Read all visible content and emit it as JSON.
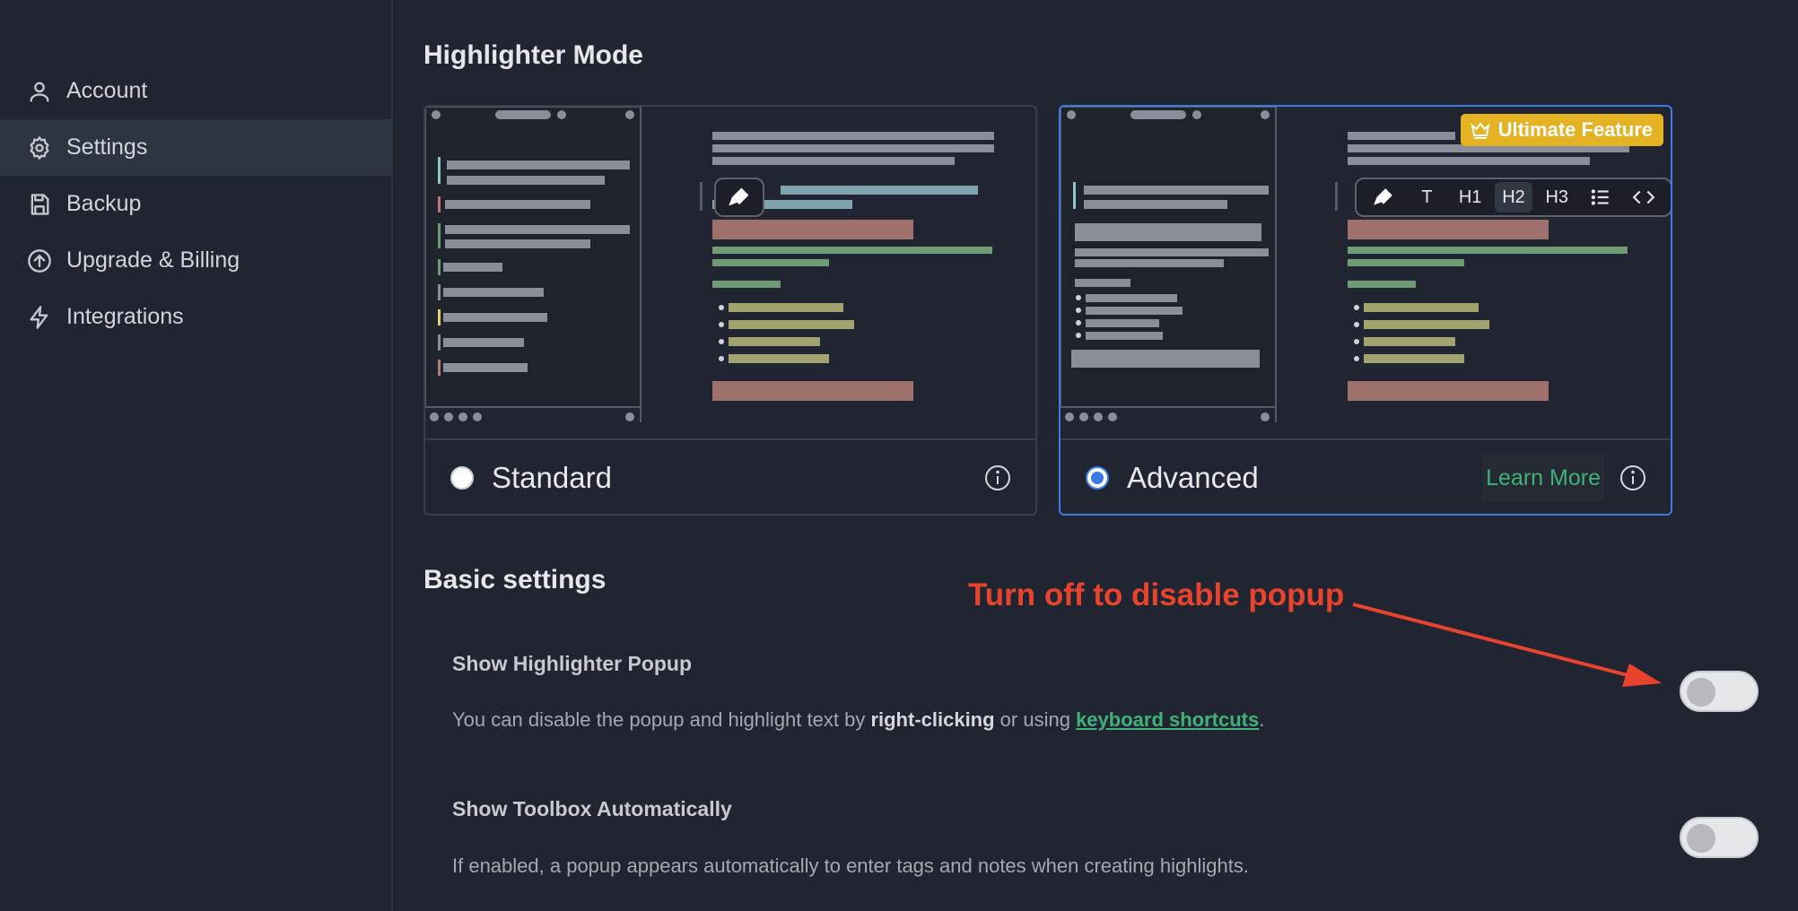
{
  "sidebar": {
    "items": [
      {
        "label": "Account",
        "icon": "user-icon",
        "active": false
      },
      {
        "label": "Settings",
        "icon": "gear-icon",
        "active": true
      },
      {
        "label": "Backup",
        "icon": "save-icon",
        "active": false
      },
      {
        "label": "Upgrade & Billing",
        "icon": "upgrade-icon",
        "active": false
      },
      {
        "label": "Integrations",
        "icon": "lightning-icon",
        "active": false
      }
    ]
  },
  "highlighter_mode": {
    "title": "Highlighter Mode",
    "options": [
      {
        "label": "Standard",
        "selected": false
      },
      {
        "label": "Advanced",
        "selected": true,
        "badge": "Ultimate Feature",
        "learn_more": "Learn More"
      }
    ],
    "toolbar_buttons": [
      "highlighter-icon",
      "T",
      "H1",
      "H2",
      "H3",
      "list-icon",
      "code-icon"
    ],
    "toolbar_active": "H2"
  },
  "basic_settings": {
    "title": "Basic settings",
    "show_popup": {
      "title": "Show Highlighter Popup",
      "desc_prefix": "You can disable the popup and highlight text by ",
      "desc_bold": "right-clicking",
      "desc_mid": " or using ",
      "desc_link": "keyboard shortcuts",
      "desc_suffix": ".",
      "enabled": false
    },
    "show_toolbox": {
      "title": "Show Toolbox Automatically",
      "desc": "If enabled, a popup appears automatically to enter tags and notes when creating highlights.",
      "enabled": false
    }
  },
  "annotation": {
    "text": "Turn off to disable popup",
    "color": "#e8432d"
  },
  "colors": {
    "background": "#212531",
    "accent_blue": "#3a7be5",
    "accent_green": "#3fb27a",
    "badge_gold": "#e4b223"
  }
}
